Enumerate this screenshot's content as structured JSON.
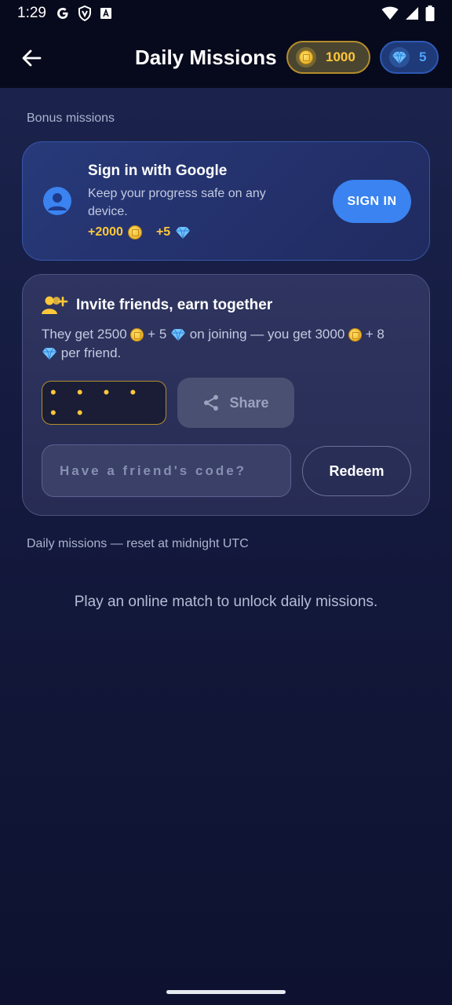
{
  "status_bar": {
    "time": "1:29",
    "icons": [
      "google-g-icon",
      "shield-icon",
      "font-a-icon",
      "wifi-icon",
      "signal-icon",
      "battery-icon"
    ]
  },
  "header": {
    "title": "Daily Missions",
    "coins": "1000",
    "gems": "5",
    "colors": {
      "coin": "#ffc73a",
      "gem": "#4ea2ff",
      "background": "#070a1c"
    }
  },
  "bonus": {
    "section_label": "Bonus missions",
    "google": {
      "title": "Sign in with Google",
      "description": "Keep your progress safe on any device.",
      "coin_reward": "+2000",
      "gem_reward": "+5",
      "button_label": "SIGN IN",
      "accent": "#3a83f0"
    },
    "invite": {
      "title": "Invite friends, earn together",
      "desc_part1": "They get 2500",
      "desc_part2": "+ 5",
      "desc_part3": "on joining — you get 3000",
      "desc_part4": "+ 8",
      "desc_part5": "per friend.",
      "code_mask": "• • • • • •",
      "share_label": "Share",
      "code_placeholder": "Have a friend's code?",
      "redeem_label": "Redeem"
    }
  },
  "daily": {
    "section_label": "Daily missions — reset at midnight UTC",
    "empty_message": "Play an online match to unlock daily missions."
  }
}
